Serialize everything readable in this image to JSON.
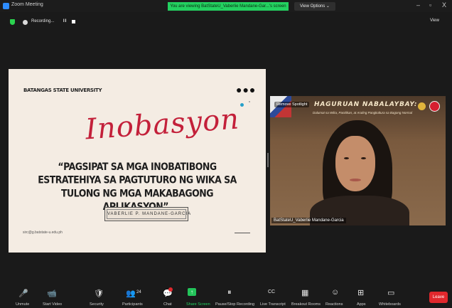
{
  "window": {
    "app_title": "Zoom Meeting",
    "viewing_banner": "You are viewing BatStateU_Vaberlie Mandane-Gar...'s screen",
    "view_options": "View Options ⌄",
    "minimize": "–",
    "maximize": "▫",
    "close": "X"
  },
  "status": {
    "recording_label": "Recording...",
    "pause_symbol": "II",
    "view_label": "View"
  },
  "slide": {
    "university": "BATANGAS STATE UNIVERSITY",
    "dots": "●●●",
    "script_title": "Inobasyon",
    "quote": "“PAGSIPAT SA MGA INOBATIBONG ESTRATEHIYA SA PAGTUTURO NG WIKA SA TULONG NG MGA MAKABAGONG APLIKASYON”.",
    "author": "VABERLIE P. MANDANE-GARCIA",
    "email": "sirc@g.batstate-u.edu.ph"
  },
  "video": {
    "spotlight": "Remove Spotlight",
    "title": "HAGURUAN NABALAYBAY:",
    "subtitle": "Dalumat sa Wika, Panitikan, at Araling Pangkultura sa Bagong Normal",
    "name_tag": "BatStateU_Vaberlie Mandane-Garcia"
  },
  "toolbar": {
    "items": [
      {
        "label": "Unmute",
        "icon": "🎤"
      },
      {
        "label": "Start Video",
        "icon": "📹"
      },
      {
        "label": "Security",
        "icon": "🛡"
      },
      {
        "label": "Participants",
        "icon": "👥"
      },
      {
        "label": "Chat",
        "icon": "💬"
      },
      {
        "label": "Share Screen",
        "icon": "↑"
      },
      {
        "label": "Pause/Stop Recording",
        "icon": "⏸"
      },
      {
        "label": "Live Transcript",
        "icon": "CC"
      },
      {
        "label": "Breakout Rooms",
        "icon": "▦"
      },
      {
        "label": "Reactions",
        "icon": "☺"
      },
      {
        "label": "Apps",
        "icon": "⊞"
      },
      {
        "label": "Whiteboards",
        "icon": "▭"
      }
    ],
    "participants_count": "24",
    "leave_label": "Leave"
  },
  "colors": {
    "accent_green": "#23d160",
    "leave_red": "#e0282d",
    "title_red": "#c3203a"
  }
}
